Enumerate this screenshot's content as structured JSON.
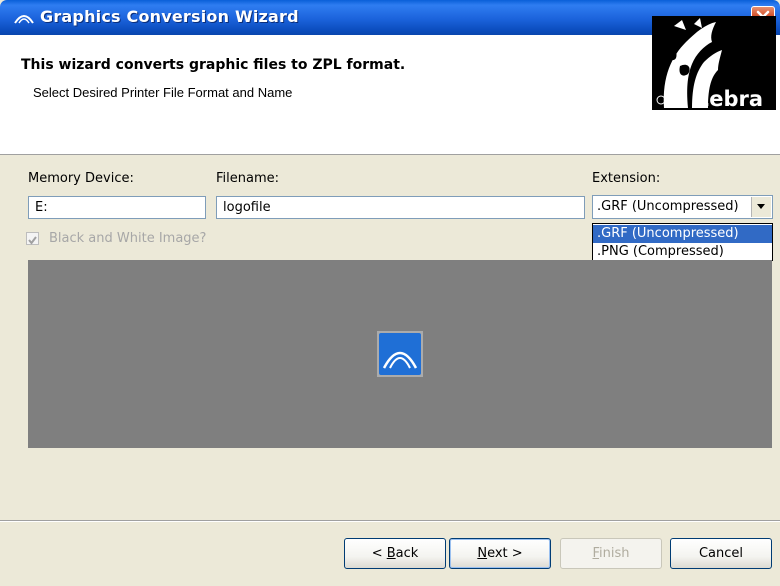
{
  "window": {
    "title": "Graphics Conversion Wizard"
  },
  "header": {
    "title": "This wizard converts graphic files to ZPL format.",
    "subtitle": "Select Desired Printer File Format and Name",
    "logo_text": "Zebra"
  },
  "form": {
    "memory_device": {
      "label": "Memory Device:",
      "value": "E:"
    },
    "filename": {
      "label": "Filename:",
      "value": "logofile"
    },
    "extension": {
      "label": "Extension:",
      "value": ".GRF (Uncompressed)",
      "options": [
        ".GRF (Uncompressed)",
        ".PNG (Compressed)"
      ]
    },
    "bw_checkbox": {
      "label": "Black and White Image?",
      "checked": true,
      "enabled": false
    }
  },
  "buttons": {
    "back": {
      "mnemonic": "B",
      "rest": "ack",
      "prefix": "< "
    },
    "next": {
      "mnemonic": "N",
      "rest": "ext >"
    },
    "finish": {
      "mnemonic": "F",
      "rest": "inish"
    },
    "cancel": "Cancel"
  },
  "colors": {
    "titlebar": "#0a5fd8",
    "preview_bg": "#7f7f7f",
    "selection": "#316ac5"
  },
  "icons": {
    "title": "zebra-arc-icon",
    "close": "close-icon",
    "preview": "zebra-arc-icon",
    "dropdown": "chevron-down-icon",
    "logo": "zebra-logo"
  }
}
